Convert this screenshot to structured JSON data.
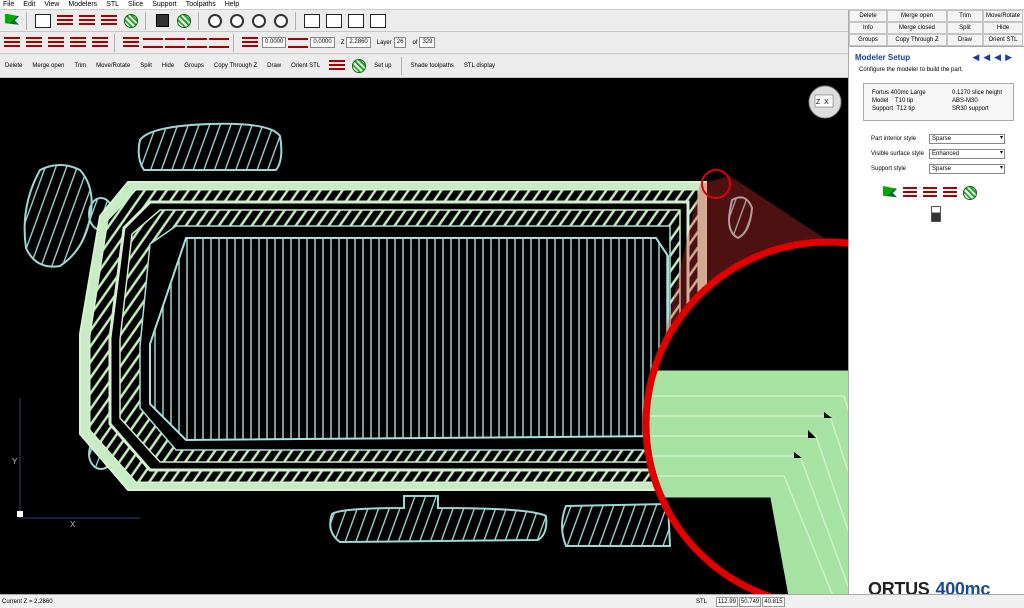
{
  "menu": [
    "File",
    "Edit",
    "View",
    "Modelers",
    "STL",
    "Slice",
    "Support",
    "Toolpaths",
    "Help"
  ],
  "toolbar2": {
    "field1": "0.0000",
    "field2": "0.0000",
    "z_label": "Z",
    "z_value": "2.2860",
    "layer_label": "Layer",
    "layer_value": "26",
    "of_label": "of",
    "layer_total": "329"
  },
  "toolbar3": {
    "items": [
      "Delete",
      "Merge open",
      "Trim",
      "Move/Rotate",
      "Split",
      "Hide",
      "Groups",
      "Copy Through Z",
      "Draw",
      "Orient STL"
    ],
    "setup": "Set up",
    "shade": "Shade toolpaths",
    "stl_display": "STL display"
  },
  "commands": [
    [
      "Delete",
      "Merge open",
      "Trim",
      "Move/Rotate"
    ],
    [
      "Info",
      "Merge closed",
      "Split",
      "Hide"
    ],
    [
      "Groups",
      "Copy Through Z",
      "Draw",
      "Orient STL"
    ]
  ],
  "setup": {
    "title": "Modeler Setup",
    "description": "Configure the modeler to build the part.",
    "info": {
      "machine": "Fortus 400mc Large",
      "slice": "0.1270 slice height",
      "model_label": "Model",
      "model_tip": "T10 tip",
      "model_material": "ABS-M30",
      "support_label": "Support",
      "support_tip": "T12 tip",
      "support_material": "SR30 support"
    },
    "options": [
      {
        "label": "Part interior style",
        "value": "Sparse"
      },
      {
        "label": "Visible surface style",
        "value": "Enhanced"
      },
      {
        "label": "Support style",
        "value": "Sparse"
      }
    ]
  },
  "viewport": {
    "axis_y": "Y",
    "axis_x": "X",
    "cube_label": "Z",
    "cube_label2": "X"
  },
  "status": {
    "current_z": "Current Z = 2.2860",
    "mode": "STL",
    "c1": "112.99",
    "c2": "50.749",
    "c3": "40.815"
  },
  "brand": {
    "part1": "ORTUS",
    "part2": "400mc"
  },
  "colors": {
    "part_fill": "#b3dfb0",
    "toolpath": "#9fd6d6",
    "zoom_ring": "#e00000",
    "viewport_bg": "#000000"
  }
}
